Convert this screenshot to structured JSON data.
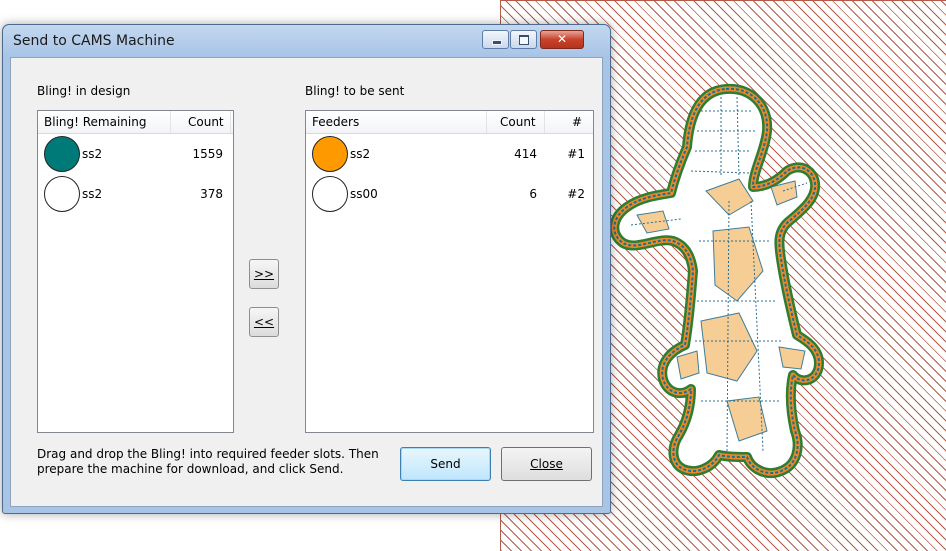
{
  "dialog": {
    "title": "Send to CAMS Machine",
    "left_group_label": "Bling! in design",
    "right_group_label": "Bling! to be sent",
    "hint": "Drag and drop the Bling! into required feeder slots. Then prepare the machine for download, and click Send.",
    "add_button_label": ">>",
    "remove_button_label": "<<",
    "send_label": "Send",
    "close_label": "Close"
  },
  "left_list": {
    "headers": [
      "Bling! Remaining",
      "Count"
    ],
    "rows": [
      {
        "name": "ss2",
        "count": "1559",
        "color": "#007a78"
      },
      {
        "name": "ss2",
        "count": "378",
        "color": "#ffffff"
      }
    ]
  },
  "right_list": {
    "headers": [
      "Feeders",
      "Count",
      "#"
    ],
    "rows": [
      {
        "name": "ss2",
        "count": "414",
        "slot": "#1",
        "color": "#ff9900"
      },
      {
        "name": "ss00",
        "count": "6",
        "slot": "#2",
        "color": "#ffffff"
      }
    ]
  },
  "colors": {
    "teal_bling": "#007a78",
    "orange_bling": "#ff9900",
    "hatch": "#b35a48"
  },
  "icons": [
    "minimize-icon",
    "maximize-icon",
    "close-icon",
    "bling-circle-icon"
  ]
}
